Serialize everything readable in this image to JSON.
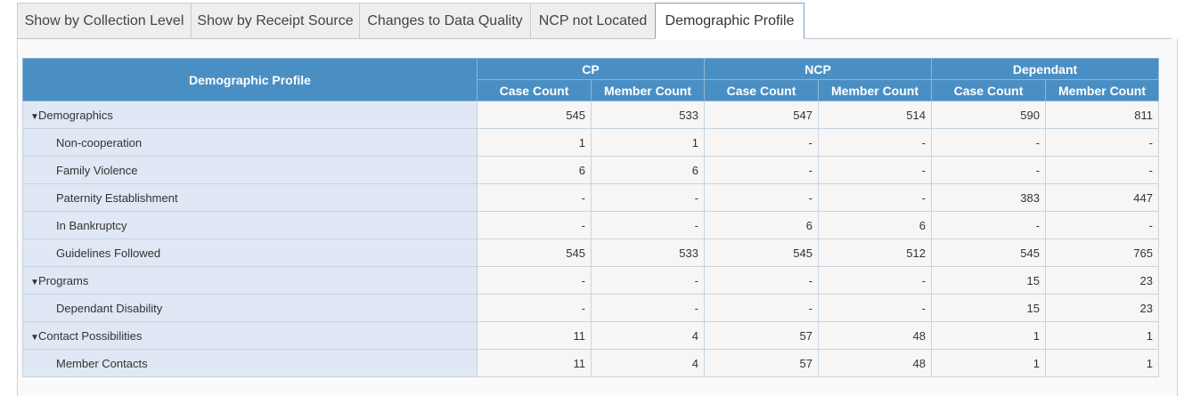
{
  "tabs": [
    {
      "label": "Show by Collection Level",
      "active": false
    },
    {
      "label": "Show by Receipt Source",
      "active": false
    },
    {
      "label": "Changes to Data Quality",
      "active": false
    },
    {
      "label": "NCP not Located",
      "active": false
    },
    {
      "label": "Demographic Profile",
      "active": true
    }
  ],
  "table": {
    "corner_header": "Demographic Profile",
    "groups": [
      "CP",
      "NCP",
      "Dependant"
    ],
    "subheaders": [
      "Case Count",
      "Member Count",
      "Case Count",
      "Member Count",
      "Case Count",
      "Member Count"
    ],
    "expand_icon": "triangle-down-icon",
    "rows": [
      {
        "label": "Demographics",
        "level": 0,
        "values": [
          "545",
          "533",
          "547",
          "514",
          "590",
          "811"
        ]
      },
      {
        "label": "Non-cooperation",
        "level": 1,
        "values": [
          "1",
          "1",
          "-",
          "-",
          "-",
          "-"
        ]
      },
      {
        "label": "Family Violence",
        "level": 1,
        "values": [
          "6",
          "6",
          "-",
          "-",
          "-",
          "-"
        ]
      },
      {
        "label": "Paternity Establishment",
        "level": 1,
        "values": [
          "-",
          "-",
          "-",
          "-",
          "383",
          "447"
        ]
      },
      {
        "label": "In Bankruptcy",
        "level": 1,
        "values": [
          "-",
          "-",
          "6",
          "6",
          "-",
          "-"
        ]
      },
      {
        "label": "Guidelines Followed",
        "level": 1,
        "values": [
          "545",
          "533",
          "545",
          "512",
          "545",
          "765"
        ]
      },
      {
        "label": "Programs",
        "level": 0,
        "values": [
          "-",
          "-",
          "-",
          "-",
          "15",
          "23"
        ]
      },
      {
        "label": "Dependant Disability",
        "level": 1,
        "values": [
          "-",
          "-",
          "-",
          "-",
          "15",
          "23"
        ]
      },
      {
        "label": "Contact Possibilities",
        "level": 0,
        "values": [
          "11",
          "4",
          "57",
          "48",
          "1",
          "1"
        ]
      },
      {
        "label": "Member Contacts",
        "level": 1,
        "values": [
          "11",
          "4",
          "57",
          "48",
          "1",
          "1"
        ]
      }
    ]
  },
  "colors": {
    "header_bg": "#4a8fc4",
    "label_bg": "#dfe8f4",
    "cell_bg": "#f7f6f5",
    "tab_bg": "#eeeeee"
  }
}
